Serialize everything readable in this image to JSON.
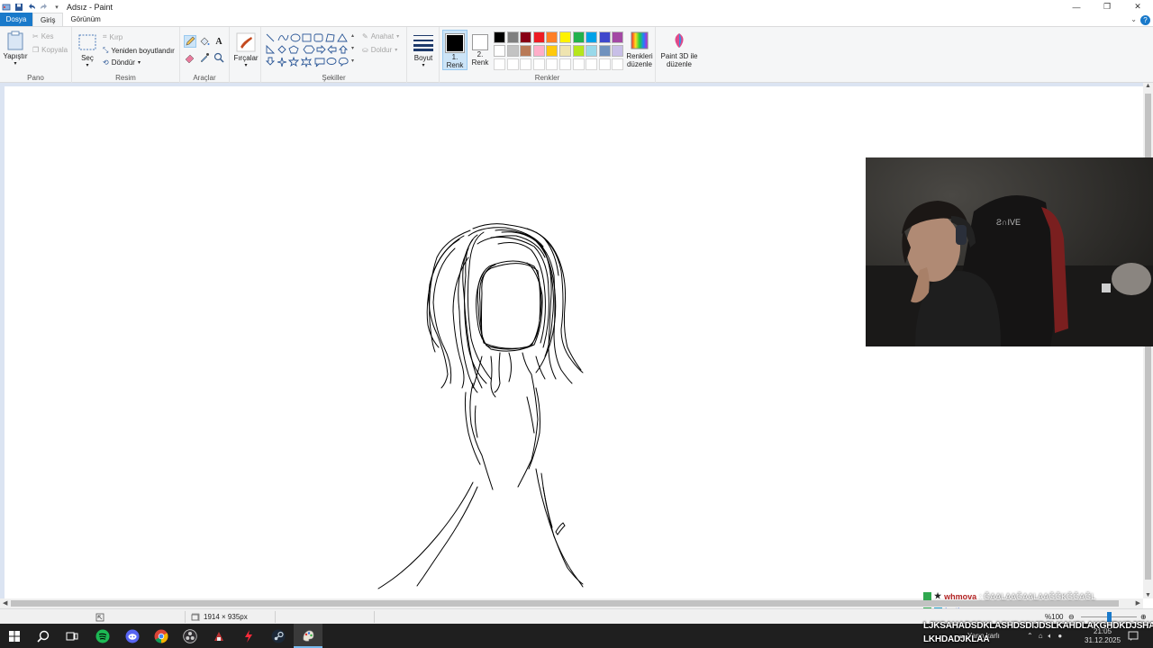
{
  "window": {
    "title": "Adsız - Paint"
  },
  "tabs": {
    "file": "Dosya",
    "home": "Giriş",
    "view": "Görünüm"
  },
  "ribbon": {
    "clipboard": {
      "label": "Pano",
      "paste": "Yapıştır",
      "cut": "Kes",
      "copy": "Kopyala"
    },
    "image": {
      "label": "Resim",
      "select": "Seç",
      "crop": "Kırp",
      "resize": "Yeniden boyutlandır",
      "rotate": "Döndür"
    },
    "tools": {
      "label": "Araçlar"
    },
    "brushes": {
      "label": "Fırçalar"
    },
    "shapes": {
      "label": "Şekiller",
      "outline": "Anahat",
      "fill": "Doldur"
    },
    "size": {
      "label": "Boyut"
    },
    "colors": {
      "label": "Renkler",
      "color1": "1.\nRenk",
      "color1_a": "1.",
      "color1_b": "Renk",
      "color2_a": "2.",
      "color2_b": "Renk",
      "edit": "Renkleri düzenle",
      "edit_a": "Renkleri",
      "edit_b": "düzenle",
      "palette_row1": [
        "#000000",
        "#7f7f7f",
        "#880015",
        "#ed1c24",
        "#ff7f27",
        "#fff200",
        "#22b14c",
        "#00a2e8",
        "#3f48cc",
        "#a349a4"
      ],
      "palette_row2": [
        "#ffffff",
        "#c3c3c3",
        "#b97a57",
        "#ffaec9",
        "#ffc90e",
        "#efe4b0",
        "#b5e61d",
        "#99d9ea",
        "#7092be",
        "#c8bfe7"
      ]
    },
    "paint3d": {
      "a": "Paint 3D ile",
      "b": "düzenle"
    }
  },
  "statusbar": {
    "dimensions": "1914 × 935px",
    "zoom": "%100"
  },
  "chat": [
    {
      "user": "whmova",
      "message": ": ĞAALAAĞAALAAĞĞKĞĞAĞL",
      "color": "#b22222"
    },
    {
      "user": "lrethyn",
      "message": ":",
      "color": "#3a6ee8"
    }
  ],
  "overlay": {
    "line1": "LJKSAHADSDKLASHDSDIJDSLKAHDLAKGHDKDJSHA",
    "line2": "LKHDADJKLAA"
  },
  "tray": {
    "weather": "Yarın karlı",
    "time": "21:05",
    "date": "31.12.2025"
  },
  "colors": {
    "accent": "#1979ca",
    "ribbon_bg": "#f5f6f7",
    "workarea_bg": "#dbe4f2",
    "taskbar_bg": "#1f1f1f"
  }
}
